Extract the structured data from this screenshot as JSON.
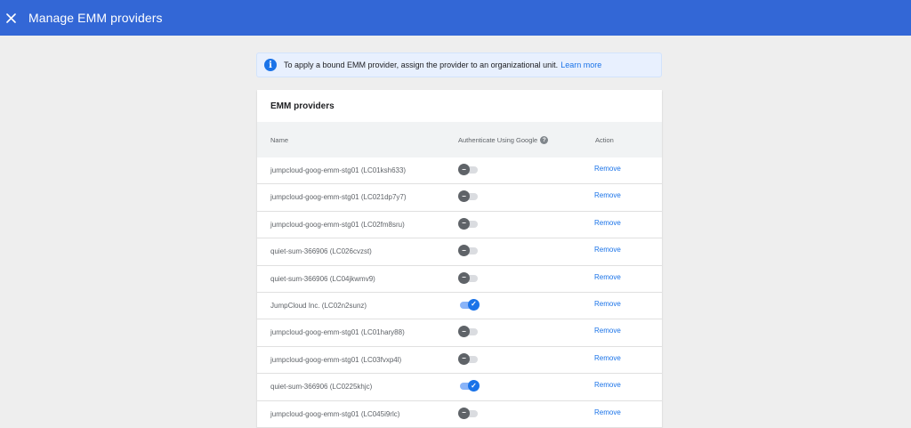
{
  "header": {
    "title": "Manage EMM providers",
    "close_icon": "close-icon"
  },
  "banner": {
    "icon": "info-icon",
    "text": "To apply a bound EMM provider, assign the provider to an organizational unit.",
    "link": "Learn more"
  },
  "providers": {
    "title": "EMM providers",
    "columns": {
      "name": "Name",
      "auth": "Authenticate Using Google",
      "action": "Action"
    },
    "action_label": "Remove",
    "rows": [
      {
        "name": "jumpcloud-goog-emm-stg01 (LC01ksh633)",
        "auth": false
      },
      {
        "name": "jumpcloud-goog-emm-stg01 (LC021dp7y7)",
        "auth": false
      },
      {
        "name": "jumpcloud-goog-emm-stg01 (LC02fm8sru)",
        "auth": false
      },
      {
        "name": "quiet-sum-366906 (LC026cvzst)",
        "auth": false
      },
      {
        "name": "quiet-sum-366906 (LC04jkwmv9)",
        "auth": false
      },
      {
        "name": "JumpCloud Inc. (LC02n2sunz)",
        "auth": true
      },
      {
        "name": "jumpcloud-goog-emm-stg01 (LC01hary88)",
        "auth": false
      },
      {
        "name": "jumpcloud-goog-emm-stg01 (LC03fvxp4l)",
        "auth": false
      },
      {
        "name": "quiet-sum-366906 (LC0225khjc)",
        "auth": true
      },
      {
        "name": "jumpcloud-goog-emm-stg01 (LC045i9rlc)",
        "auth": false
      }
    ]
  },
  "colors": {
    "topbar": "#3367d6",
    "accent": "#1a73e8"
  }
}
